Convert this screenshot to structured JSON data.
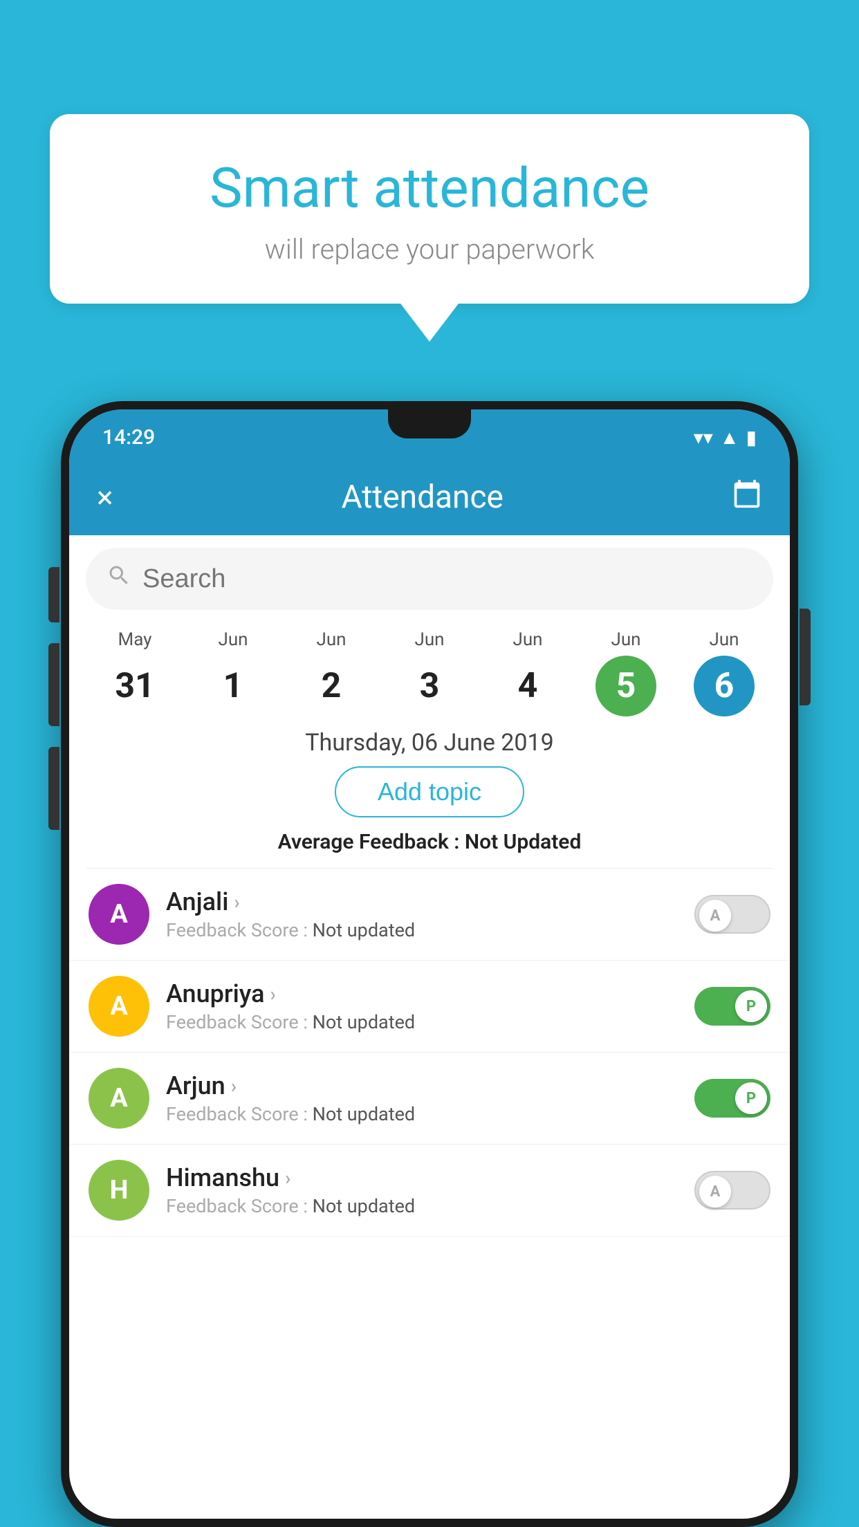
{
  "background_color": "#29B6D8",
  "speech_bubble": {
    "title": "Smart attendance",
    "subtitle": "will replace your paperwork"
  },
  "status_bar": {
    "time": "14:29",
    "wifi": "▼",
    "signal": "▲",
    "battery": "▮"
  },
  "app_bar": {
    "title": "Attendance",
    "close_label": "×",
    "calendar_label": "📅"
  },
  "search": {
    "placeholder": "Search"
  },
  "calendar": {
    "days": [
      {
        "month": "May",
        "num": "31",
        "state": "normal"
      },
      {
        "month": "Jun",
        "num": "1",
        "state": "normal"
      },
      {
        "month": "Jun",
        "num": "2",
        "state": "normal"
      },
      {
        "month": "Jun",
        "num": "3",
        "state": "normal"
      },
      {
        "month": "Jun",
        "num": "4",
        "state": "normal"
      },
      {
        "month": "Jun",
        "num": "5",
        "state": "today"
      },
      {
        "month": "Jun",
        "num": "6",
        "state": "selected"
      }
    ]
  },
  "selected_date": "Thursday, 06 June 2019",
  "add_topic_label": "Add topic",
  "avg_feedback_label": "Average Feedback :",
  "avg_feedback_value": "Not Updated",
  "students": [
    {
      "name": "Anjali",
      "feedback_label": "Feedback Score :",
      "feedback_value": "Not updated",
      "avatar_letter": "A",
      "avatar_color": "#9C27B0",
      "toggle": "off",
      "toggle_letter": "A"
    },
    {
      "name": "Anupriya",
      "feedback_label": "Feedback Score :",
      "feedback_value": "Not updated",
      "avatar_letter": "A",
      "avatar_color": "#FFC107",
      "toggle": "on",
      "toggle_letter": "P"
    },
    {
      "name": "Arjun",
      "feedback_label": "Feedback Score :",
      "feedback_value": "Not updated",
      "avatar_letter": "A",
      "avatar_color": "#8BC34A",
      "toggle": "on",
      "toggle_letter": "P"
    },
    {
      "name": "Himanshu",
      "feedback_label": "Feedback Score :",
      "feedback_value": "Not updated",
      "avatar_letter": "H",
      "avatar_color": "#8BC34A",
      "toggle": "off",
      "toggle_letter": "A"
    }
  ]
}
